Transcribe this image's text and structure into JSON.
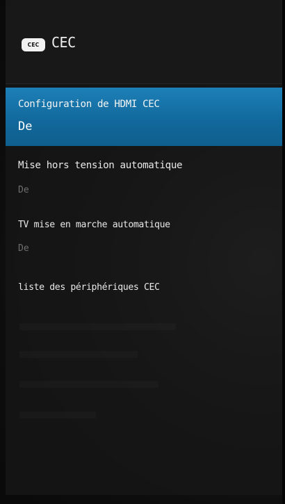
{
  "header": {
    "icon_label": "CEC",
    "title": "CEC"
  },
  "menu": {
    "items": [
      {
        "label": "Configuration de HDMI CEC",
        "value": "De",
        "selected": true
      },
      {
        "label": "Mise hors tension automatique",
        "value": "De",
        "selected": false
      },
      {
        "label": "TV mise en marche automatique",
        "value": "De",
        "selected": false
      },
      {
        "label": "liste des périphériques CEC",
        "selected": false
      }
    ]
  },
  "colors": {
    "accent": "#1a77ad",
    "panel_bg": "#161616",
    "text_primary": "#e8e8e8",
    "text_secondary": "#6f6f6f"
  }
}
